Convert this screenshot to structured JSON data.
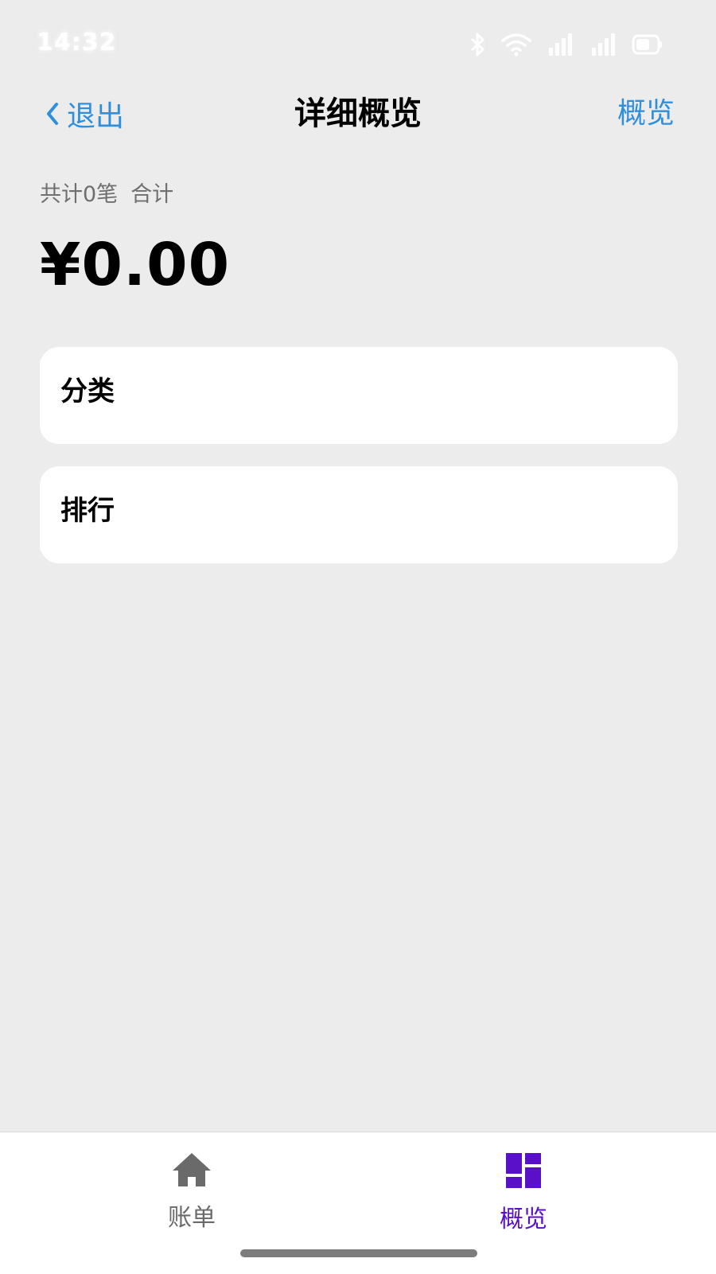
{
  "status_bar": {
    "time": "14:32"
  },
  "nav": {
    "back_label": "退出",
    "title": "详细概览",
    "right_label": "概览"
  },
  "summary": {
    "count_text": "共计0笔",
    "total_label": "合计",
    "amount": "¥0.00"
  },
  "cards": {
    "category_title": "分类",
    "ranking_title": "排行"
  },
  "tabs": {
    "bills_label": "账单",
    "overview_label": "概览"
  },
  "colors": {
    "accent_link": "#2f8fdc",
    "active_tab": "#5a0fc8",
    "inactive_tab": "#6a6a6a",
    "background": "#ececec"
  },
  "icons": {
    "back": "chevron-left-icon",
    "bills_tab": "home-icon",
    "overview_tab": "dashboard-grid-icon"
  }
}
